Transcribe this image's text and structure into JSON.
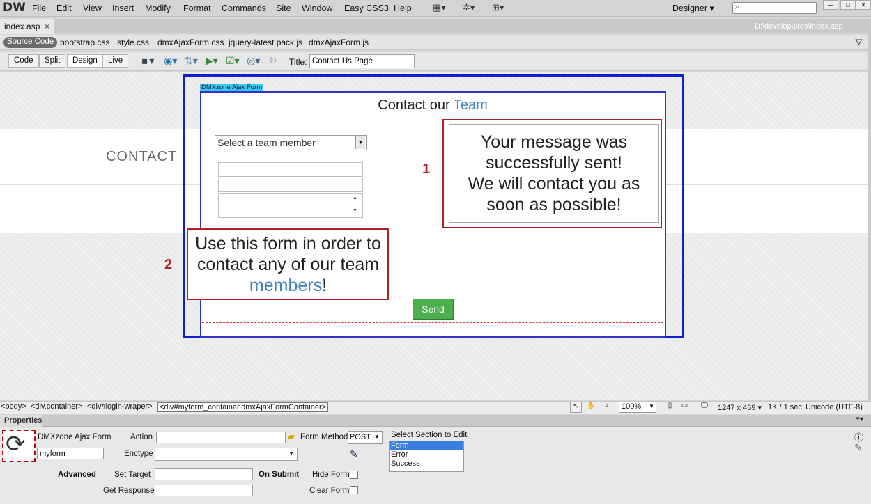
{
  "app": {
    "logo": "DW"
  },
  "menu": [
    "File",
    "Edit",
    "View",
    "Insert",
    "Modify",
    "Format",
    "Commands",
    "Site",
    "Window",
    "Easy CSS3",
    "Help"
  ],
  "workspace": {
    "label": "Designer ▾"
  },
  "document": {
    "tab": "index.asp",
    "close": "×",
    "path": "D:\\develop\\tires\\index.asp",
    "related": {
      "source": "Source Code",
      "files": [
        "bootstrap.css",
        "style.css",
        "dmxAjaxForm.css",
        "jquery-latest.pack.js",
        "dmxAjaxForm.js"
      ]
    }
  },
  "toolbar": {
    "code": "Code",
    "split": "Split",
    "design": "Design",
    "live": "Live",
    "title_label": "Title:",
    "title_value": "Contact Us Page"
  },
  "page": {
    "contact_heading": "CONTACT",
    "form_label": "DMXzone Ajax Form",
    "form_heading_prefix": "Contact our ",
    "form_heading_highlight": "Team",
    "select_placeholder": "Select a team member",
    "success_message_line1": "Your message was",
    "success_message_line2": "successfully sent!",
    "success_message_line3": "We will contact you as",
    "success_message_line4": "soon as possible!",
    "intro_line1": "Use this form in order to",
    "intro_line2": "contact any of our team",
    "intro_highlight": "members",
    "intro_end": "!",
    "send_button": "Send",
    "marker1": "1",
    "marker2": "2"
  },
  "status": {
    "tags": [
      "<body>",
      "<div.container>",
      "<div#login-wraper>"
    ],
    "selected_tag": "<div#myform_container.dmxAjaxFormContainer>",
    "zoom": "100%",
    "size": "1247 x 469 ▾",
    "download": "1K / 1 sec",
    "encoding": "Unicode (UTF-8)"
  },
  "properties": {
    "tab": "Properties",
    "element_type": "DMXzone Ajax Form",
    "form_id": "myform",
    "action_label": "Action",
    "form_method_label": "Form Method",
    "form_method_value": "POST",
    "enctype_label": "Enctype",
    "section_label": "Select Section to Edit",
    "sections": [
      "Form",
      "Error",
      "Success"
    ],
    "advanced_label": "Advanced",
    "set_target_label": "Set Target",
    "get_response_label": "Get Response",
    "on_submit_label": "On Submit",
    "hide_form_label": "Hide Form",
    "clear_form_label": "Clear Form"
  },
  "colors": {
    "accent_blue": "#3e82c5",
    "annotation_red": "#b22222",
    "send_green": "#4cae4c"
  }
}
